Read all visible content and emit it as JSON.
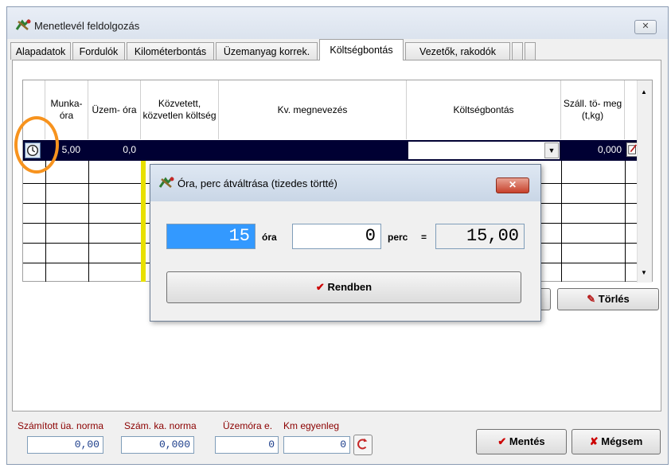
{
  "window": {
    "title": "Menetlevél feldolgozás",
    "close_label": "✕"
  },
  "tabs": [
    {
      "label": "Alapadatok"
    },
    {
      "label": "Fordulók"
    },
    {
      "label": "Kilométerbontás"
    },
    {
      "label": "Üzemanyag korrek."
    },
    {
      "label": "Költségbontás",
      "active": true
    },
    {
      "label": "Vezetők, rakodók"
    }
  ],
  "grid": {
    "headers": {
      "munka_ora": "Munka- óra",
      "uzem_ora": "Üzem- óra",
      "kozvetett": "Közvetett, közvetlen költség",
      "kv_megnevezes": "Kv. megnevezés",
      "koltsegbontas": "Költségbontás",
      "szall_tomeg": "Száll. tö- meg (t,kg)"
    },
    "selected_row": {
      "munka_ora": "5,00",
      "uzem_ora": "0,0",
      "szall_tomeg": "0,000"
    }
  },
  "buttons": {
    "torles": "Törlés",
    "mentes": "Mentés",
    "megsem": "Mégsem"
  },
  "status": {
    "szamitott_label": "Számított üa. norma",
    "szamitott_value": "0,00",
    "szam_ka_label": "Szám. ka. norma",
    "szam_ka_value": "0,000",
    "uzemora_label": "Üzemóra e.",
    "uzemora_value": "0",
    "km_label": "Km egyenleg",
    "km_value": "0"
  },
  "dialog": {
    "title": "Óra, perc átváltrása (tizedes törtté)",
    "close_label": "✕",
    "hours_value": "15",
    "hours_label": "óra",
    "minutes_value": "0",
    "minutes_label": "perc",
    "equals": "=",
    "result_value": "15,00",
    "ok_label": "Rendben"
  },
  "colors": {
    "selected_row_bg": "#000033",
    "status_label": "#8b0000",
    "highlight_ring": "#f7931e",
    "checkmark": "#cc0000"
  }
}
